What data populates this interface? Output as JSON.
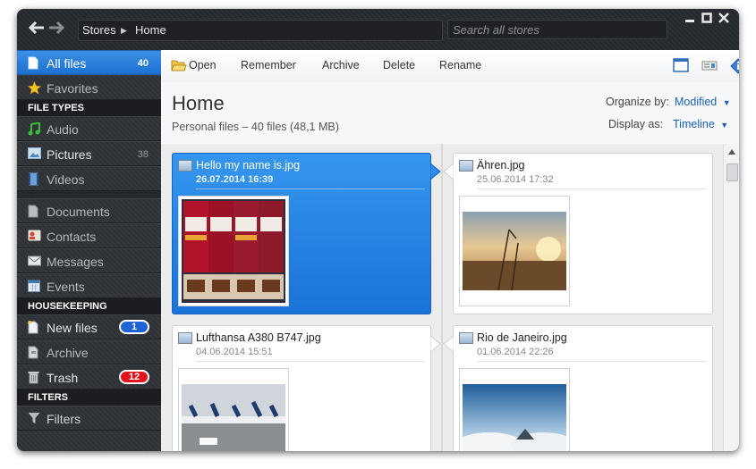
{
  "titlebar": {
    "breadcrumb": [
      "Stores",
      "Home"
    ],
    "search_placeholder": "Search all stores"
  },
  "sidebar": {
    "top": [
      {
        "label": "All files",
        "count": "40",
        "icon": "document-icon"
      },
      {
        "label": "Favorites",
        "icon": "star-icon"
      }
    ],
    "file_types_header": "FILE TYPES",
    "file_types": [
      {
        "label": "Audio",
        "icon": "music-note-icon"
      },
      {
        "label": "Pictures",
        "count": "38",
        "icon": "picture-icon"
      },
      {
        "label": "Videos",
        "icon": "film-icon"
      }
    ],
    "other": [
      {
        "label": "Documents",
        "icon": "document-icon"
      },
      {
        "label": "Contacts",
        "icon": "contact-card-icon"
      },
      {
        "label": "Messages",
        "icon": "envelope-icon"
      },
      {
        "label": "Events",
        "icon": "calendar-icon"
      }
    ],
    "housekeeping_header": "HOUSEKEEPING",
    "housekeeping": [
      {
        "label": "New files",
        "badge": "1",
        "badge_color": "#1e63d6",
        "icon": "new-file-icon"
      },
      {
        "label": "Archive",
        "icon": "archive-icon"
      },
      {
        "label": "Trash",
        "badge": "12",
        "badge_color": "#e0121a",
        "icon": "trash-icon"
      }
    ],
    "filters_header": "FILTERS",
    "filters": [
      {
        "label": "Filters",
        "icon": "funnel-icon"
      }
    ]
  },
  "toolbar": {
    "open": "Open",
    "remember": "Remember",
    "archive": "Archive",
    "delete": "Delete",
    "rename": "Rename"
  },
  "header": {
    "title": "Home",
    "subtitle": "Personal files – 40 files (48,1 MB)",
    "organize_label": "Organize by:",
    "organize_value": "Modified",
    "display_label": "Display as:",
    "display_value": "Timeline"
  },
  "files": [
    {
      "name": "Hello my name is.jpg",
      "date": "26.07.2014 16:39",
      "selected": true
    },
    {
      "name": "Ähren.jpg",
      "date": "25.06.2014 17:32"
    },
    {
      "name": "Lufthansa A380 B747.jpg",
      "date": "04.06.2014 15:51"
    },
    {
      "name": "Rio de Janeiro.jpg",
      "date": "01.06.2014 22:26"
    }
  ],
  "colors": {
    "accent": "#1c6fcf",
    "selected_card": "#2384e2"
  }
}
